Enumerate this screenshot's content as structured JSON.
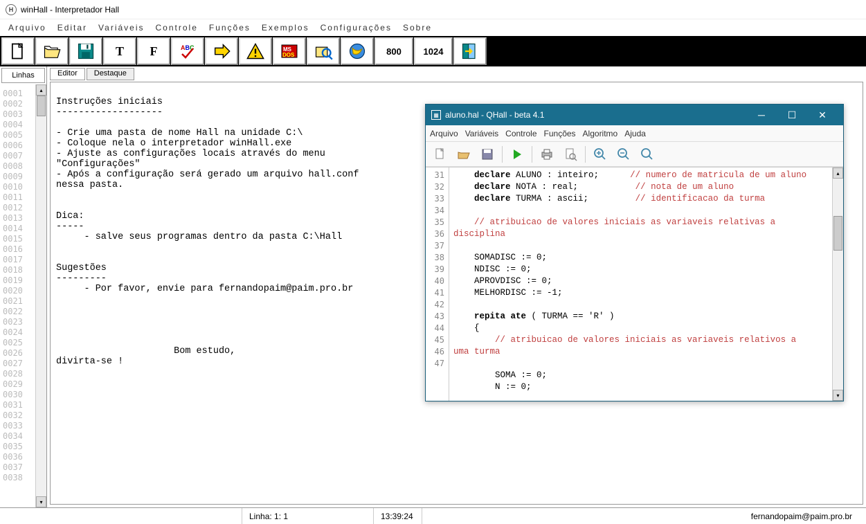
{
  "title": "winHall - Interpretador Hall",
  "title_icon": "H",
  "menubar": [
    "Arquivo",
    "Editar",
    "Variáveis",
    "Controle",
    "Funções",
    "Exemplos",
    "Configurações",
    "Sobre"
  ],
  "toolbar": {
    "t_label": "T",
    "f_label": "F",
    "abc_label": "ABC",
    "msdos_label": "MS\nDOS",
    "res1": "800",
    "res2": "1024"
  },
  "linhas_tab": "Linhas",
  "line_numbers": [
    "0001",
    "0002",
    "0003",
    "0004",
    "0005",
    "0006",
    "0007",
    "0008",
    "0009",
    "0010",
    "0011",
    "0012",
    "0013",
    "0014",
    "0015",
    "0016",
    "0017",
    "0018",
    "0019",
    "0020",
    "0021",
    "0022",
    "0023",
    "0024",
    "0025",
    "0026",
    "0027",
    "0028",
    "0029",
    "0030",
    "0031",
    "0032",
    "0033",
    "0034",
    "0035",
    "0036",
    "0037",
    "0038"
  ],
  "editor_tabs": {
    "active": "Editor",
    "inactive": "Destaque"
  },
  "editor_text": "\nInstruções iniciais\n-------------------\n\n- Crie uma pasta de nome Hall na unidade C:\\\n- Coloque nela o interpretador winHall.exe\n- Ajuste as configurações locais através do menu\n\"Configurações\"\n- Após a configuração será gerado um arquivo hall.conf\nnessa pasta.\n\n\nDica:\n-----\n     - salve seus programas dentro da pasta C:\\Hall\n\n\nSugestões\n---------\n     - Por favor, envie para fernandopaim@paim.pro.br\n\n\n\n\n\n                     Bom estudo,\ndivirta-se !",
  "statusbar": {
    "linecol": "Linha: 1: 1",
    "time": "13:39:24",
    "email": "fernandopaim@paim.pro.br"
  },
  "qhall": {
    "title": "aluno.hal - QHall - beta 4.1",
    "menu": [
      "Arquivo",
      "Variáveis",
      "Controle",
      "Funções",
      "Algoritmo",
      "Ajuda"
    ],
    "gutter": [
      "31",
      "32",
      "33",
      "34",
      "35",
      "36",
      "37",
      "38",
      "39",
      "40",
      "41",
      "42",
      "43",
      "44",
      "",
      "45",
      "46",
      "47"
    ],
    "code": [
      {
        "indent": "    ",
        "kw": "declare ",
        "rest": "ALUNO : inteiro;",
        "pad": "      ",
        "cm": "// numero de matricula de um aluno"
      },
      {
        "indent": "    ",
        "kw": "declare ",
        "rest": "NOTA : real;",
        "pad": "           ",
        "cm": "// nota de um aluno"
      },
      {
        "indent": "    ",
        "kw": "declare ",
        "rest": "TURMA : ascii;",
        "pad": "         ",
        "cm": "// identificacao da turma"
      },
      {
        "plain": ""
      },
      {
        "indent": "    ",
        "cm": "// atribuicao de valores iniciais as variaveis relativas a",
        "wrap": "disciplina"
      },
      {
        "plain": ""
      },
      {
        "plain": "    SOMADISC := 0;"
      },
      {
        "plain": "    NDISC := 0;"
      },
      {
        "plain": "    APROVDISC := 0;"
      },
      {
        "plain": "    MELHORDISC := -1;"
      },
      {
        "plain": ""
      },
      {
        "indent": "    ",
        "kw": "repita ate ",
        "rest": "( TURMA == 'R' )"
      },
      {
        "plain": "    {"
      },
      {
        "indent": "        ",
        "cm": "// atribuicao de valores iniciais as variaveis relativos a",
        "wrap": "uma turma"
      },
      {
        "plain": ""
      },
      {
        "plain": "        SOMA := 0;"
      },
      {
        "plain": "        N := 0;"
      }
    ]
  }
}
